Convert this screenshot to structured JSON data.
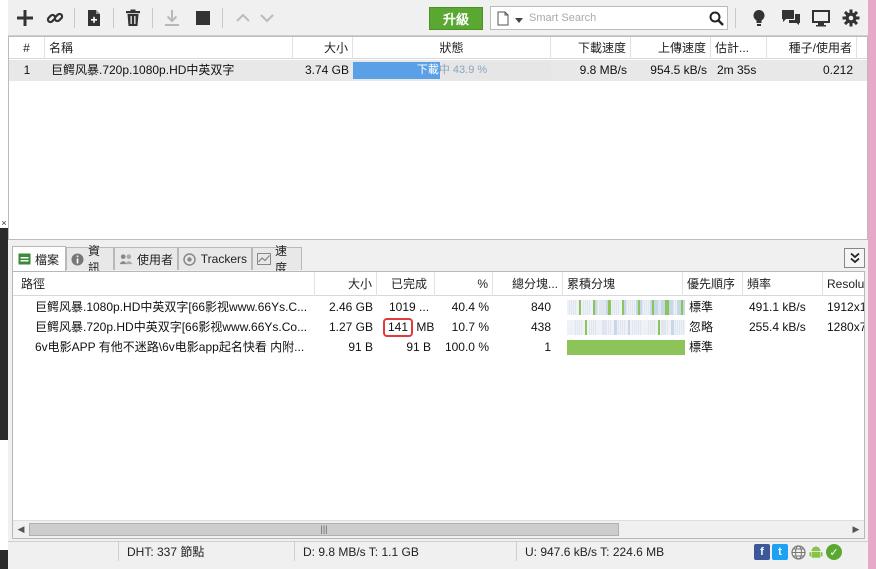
{
  "toolbar": {
    "add_icon": "plus-icon",
    "add_link_icon": "link-icon",
    "create_icon": "new-file-icon",
    "remove_icon": "trash-icon",
    "download_icon": "download-arrow-icon",
    "stop_icon": "stop-icon",
    "up_icon": "chevron-up-icon",
    "down_icon": "chevron-down-icon",
    "upgrade_label": "升級",
    "search_placeholder": "Smart Search",
    "accent": "#5aa832"
  },
  "torrents": {
    "columns": [
      "#",
      "名稱",
      "大小",
      "狀態",
      "下載速度",
      "上傳速度",
      "估計...",
      "種子/使用者"
    ],
    "rows": [
      {
        "index": "1",
        "name": "巨鳄风暴.720p.1080p.HD中英双字",
        "size": "3.74 GB",
        "status_text": "下載中 43.9 %",
        "status_text_white": "下載",
        "status_text_rest": "中 43.9 %",
        "progress": 0.439,
        "down_speed": "9.8 MB/s",
        "up_speed": "954.5 kB/s",
        "eta": "2m 35s",
        "ratio": "0.212"
      }
    ]
  },
  "tabs": [
    {
      "label": "檔案",
      "icon": "files-icon",
      "active": true
    },
    {
      "label": "資訊",
      "icon": "info-icon",
      "active": false
    },
    {
      "label": "使用者",
      "icon": "peers-icon",
      "active": false
    },
    {
      "label": "Trackers",
      "icon": "trackers-icon",
      "active": false
    },
    {
      "label": "速度",
      "icon": "speed-graph-icon",
      "active": false
    }
  ],
  "files": {
    "columns": [
      "路徑",
      "大小",
      "已完成",
      "%",
      "總分塊...",
      "累積分塊",
      "優先順序",
      "頻率",
      "Resolu"
    ],
    "rows": [
      {
        "path": "巨鳄风暴.1080p.HD中英双字[66影视www.66Ys.C...",
        "size": "2.46 GB",
        "done": "1019 ...",
        "done_highlight": "",
        "done_unit": "",
        "percent": "40.4 %",
        "pieces": "840",
        "pieces_fill": 0.404,
        "priority": "標準",
        "rate": "491.1 kB/s",
        "resolution": "1912x1"
      },
      {
        "path": "巨鳄风暴.720p.HD中英双字[66影视www.66Ys.Co...",
        "size": "1.27 GB",
        "done": "",
        "done_highlight": "141",
        "done_unit": "MB",
        "percent": "10.7 %",
        "pieces": "438",
        "pieces_fill": 0.107,
        "priority": "忽略",
        "rate": "255.4 kB/s",
        "resolution": "1280x7"
      },
      {
        "path": "6v电影APP 有他不迷路\\6v电影app起名快看 内附...",
        "size": "91 B",
        "done": "91 B",
        "done_highlight": "",
        "done_unit": "",
        "percent": "100.0 %",
        "pieces": "1",
        "pieces_fill": 1.0,
        "priority": "標準",
        "rate": "",
        "resolution": ""
      }
    ]
  },
  "statusbar": {
    "dht": "DHT: 337 節點",
    "download": "D: 9.8 MB/s T: 1.1 GB",
    "upload": "U: 947.6 kB/s T: 224.6 MB",
    "icons": [
      "facebook-icon",
      "twitter-icon",
      "globe-icon",
      "android-icon",
      "checkmark-icon"
    ]
  },
  "colors": {
    "progress_blue": "#5aa0e6",
    "pieces_green": "#8cc45a",
    "highlight_red": "#e03c3c"
  }
}
